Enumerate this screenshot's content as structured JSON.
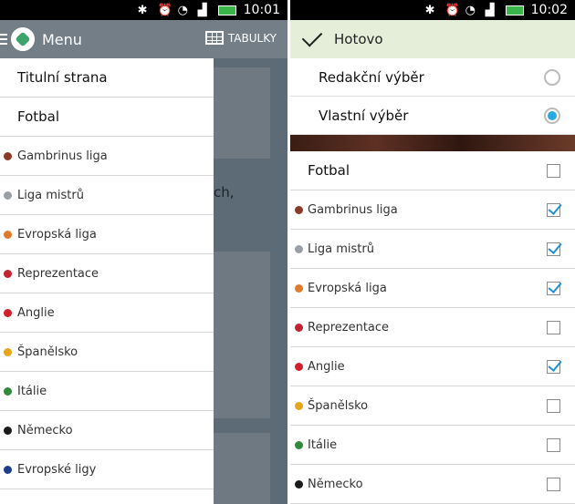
{
  "left": {
    "status": {
      "time": "10:01",
      "icons": [
        "bluetooth-icon",
        "alarm-icon",
        "wifi-icon",
        "signal-icon",
        "battery-icon"
      ]
    },
    "appbar": {
      "title": "Menu",
      "tables_label": "TABULKY"
    },
    "background_text": "ch,",
    "drawer": {
      "items": [
        {
          "label": "Titulní strana",
          "size": "big",
          "flag": ""
        },
        {
          "label": "Fotbal",
          "size": "big",
          "flag": ""
        },
        {
          "label": "Gambrinus liga",
          "size": "small",
          "flag": "#8b3a2a"
        },
        {
          "label": "Liga mistrů",
          "size": "small",
          "flag": "#9aa0a6"
        },
        {
          "label": "Evropská liga",
          "size": "small",
          "flag": "#e07b2d"
        },
        {
          "label": "Reprezentace",
          "size": "small",
          "flag": "#c3232f"
        },
        {
          "label": "Anglie",
          "size": "small",
          "flag": "#d31f2a"
        },
        {
          "label": "Španělsko",
          "size": "small",
          "flag": "#e7a61a"
        },
        {
          "label": "Itálie",
          "size": "small",
          "flag": "#2e8b3b"
        },
        {
          "label": "Německo",
          "size": "small",
          "flag": "#1b1b1b"
        },
        {
          "label": "Evropské ligy",
          "size": "small",
          "flag": "#1f3d8f"
        }
      ]
    }
  },
  "right": {
    "status": {
      "time": "10:02",
      "icons": [
        "bluetooth-icon",
        "alarm-icon",
        "wifi-icon",
        "signal-icon",
        "battery-icon"
      ]
    },
    "topbar": {
      "title": "Hotovo"
    },
    "modes": [
      {
        "label": "Redakční výběr",
        "selected": false
      },
      {
        "label": "Vlastní výběr",
        "selected": true
      }
    ],
    "categories": [
      {
        "label": "Fotbal",
        "size": "big",
        "flag": "",
        "checked": false
      },
      {
        "label": "Gambrinus liga",
        "size": "small",
        "flag": "#8b3a2a",
        "checked": true
      },
      {
        "label": "Liga mistrů",
        "size": "small",
        "flag": "#9aa0a6",
        "checked": true
      },
      {
        "label": "Evropská liga",
        "size": "small",
        "flag": "#e07b2d",
        "checked": true
      },
      {
        "label": "Reprezentace",
        "size": "small",
        "flag": "#c3232f",
        "checked": false
      },
      {
        "label": "Anglie",
        "size": "small",
        "flag": "#d31f2a",
        "checked": true
      },
      {
        "label": "Španělsko",
        "size": "small",
        "flag": "#e7a61a",
        "checked": false
      },
      {
        "label": "Itálie",
        "size": "small",
        "flag": "#2e8b3b",
        "checked": false
      },
      {
        "label": "Německo",
        "size": "small",
        "flag": "#1b1b1b",
        "checked": false
      }
    ]
  },
  "colors": {
    "accent": "#29a9e1",
    "topbar_right": "#e5eed8",
    "appbar_left": "#737e86",
    "check": "#1e8fd8"
  }
}
